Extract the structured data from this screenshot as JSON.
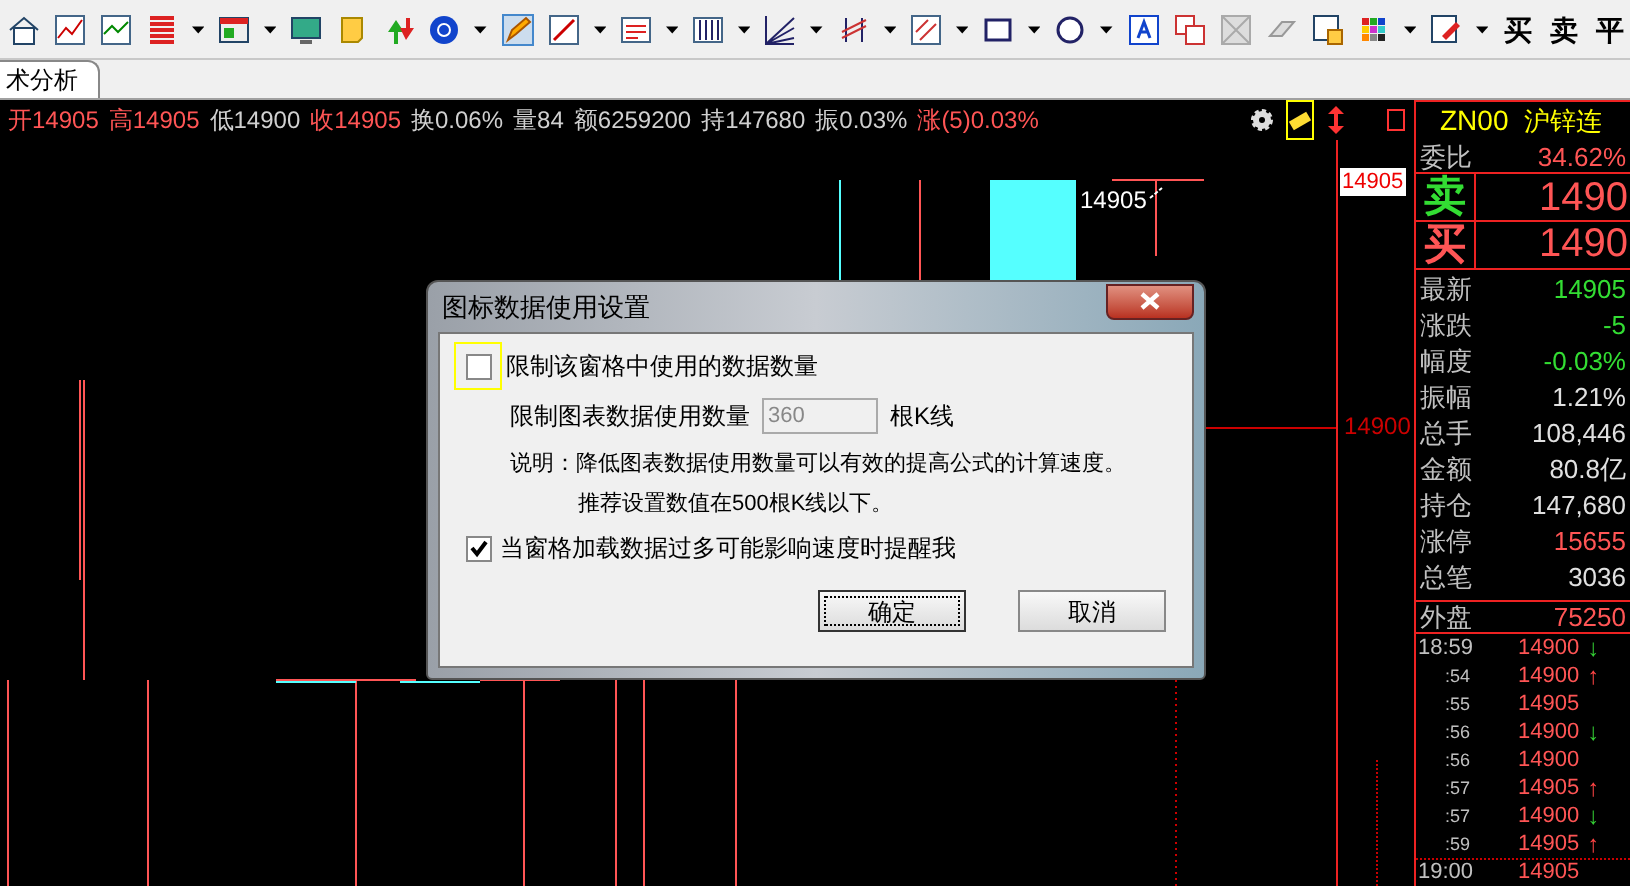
{
  "toolbar": {
    "trade_buttons": [
      "买",
      "卖",
      "平"
    ]
  },
  "tabs": [
    {
      "label": "术分析",
      "selected": true
    }
  ],
  "quote_bar": {
    "items": [
      {
        "text": "开14905",
        "color": "#ff5555"
      },
      {
        "text": "高14905",
        "color": "#ff5555"
      },
      {
        "text": "低14900",
        "color": "#d0d0d0"
      },
      {
        "text": "收14905",
        "color": "#ff5555"
      },
      {
        "text": "换0.06%",
        "color": "#d0d0d0"
      },
      {
        "text": "量84",
        "color": "#d0d0d0"
      },
      {
        "text": "额6259200",
        "color": "#d0d0d0"
      },
      {
        "text": "持147680",
        "color": "#d0d0d0"
      },
      {
        "text": "振0.03%",
        "color": "#d0d0d0"
      },
      {
        "text": "涨(5)0.03%",
        "color": "#ff5555"
      }
    ]
  },
  "chart": {
    "price_tag": "14905",
    "axis_label": "14900",
    "bar_label": "14905"
  },
  "quote_panel": {
    "symbol": "ZN00",
    "name": "沪锌连",
    "ratio": {
      "label": "委比",
      "value": "34.62%",
      "color": "#ff5555"
    },
    "sell": {
      "label": "卖",
      "value": "1490",
      "color": "#33dd33"
    },
    "buy": {
      "label": "买",
      "value": "1490",
      "color": "#ff5555"
    },
    "stats": [
      {
        "label": "最新",
        "value": "14905",
        "color": "#33dd33"
      },
      {
        "label": "涨跌",
        "value": "-5",
        "color": "#33dd33"
      },
      {
        "label": "幅度",
        "value": "-0.03%",
        "color": "#33dd33"
      },
      {
        "label": "振幅",
        "value": "1.21%",
        "color": "#e0e0e0"
      },
      {
        "label": "总手",
        "value": "108,446",
        "color": "#e0e0e0"
      },
      {
        "label": "金额",
        "value": "80.8亿",
        "color": "#e0e0e0"
      },
      {
        "label": "持仓",
        "value": "147,680",
        "color": "#e0e0e0"
      },
      {
        "label": "涨停",
        "value": "15655",
        "color": "#ff5555"
      },
      {
        "label": "总笔",
        "value": "3036",
        "color": "#e0e0e0"
      }
    ],
    "outer": {
      "label": "外盘",
      "value": "75250",
      "color": "#ff5555"
    },
    "ticks": [
      {
        "time": "18:59",
        "price": "14900",
        "arrow": "↓",
        "color": "#33cc33"
      },
      {
        "time": ":54",
        "price": "14900",
        "arrow": "↑",
        "color": "#ff4444"
      },
      {
        "time": ":55",
        "price": "14905"
      },
      {
        "time": ":56",
        "price": "14900",
        "arrow": "↓",
        "color": "#33cc33"
      },
      {
        "time": ":56",
        "price": "14900"
      },
      {
        "time": ":57",
        "price": "14905",
        "arrow": "↑",
        "color": "#ff4444"
      },
      {
        "time": ":57",
        "price": "14900",
        "arrow": "↓",
        "color": "#33cc33"
      },
      {
        "time": ":59",
        "price": "14905",
        "arrow": "↑",
        "color": "#ff4444"
      },
      {
        "time": "19:00",
        "price": "14905"
      }
    ]
  },
  "dialog": {
    "title": "图标数据使用设置",
    "limit_checkbox": {
      "label": "限制该窗格中使用的数据数量",
      "checked": false,
      "focused": true
    },
    "limit_field": {
      "label": "限制图表数据使用数量",
      "value": "360",
      "disabled": true,
      "unit": "根K线"
    },
    "note": [
      "说明：降低图表数据使用数量可以有效的提高公式的计算速度。",
      "推荐设置数值在500根K线以下。"
    ],
    "warn_checkbox": {
      "label": "当窗格加载数据过多可能影响速度时提醒我",
      "checked": true
    },
    "buttons": [
      {
        "label": "确定",
        "focused": true
      },
      {
        "label": "取消",
        "focused": false
      }
    ]
  }
}
